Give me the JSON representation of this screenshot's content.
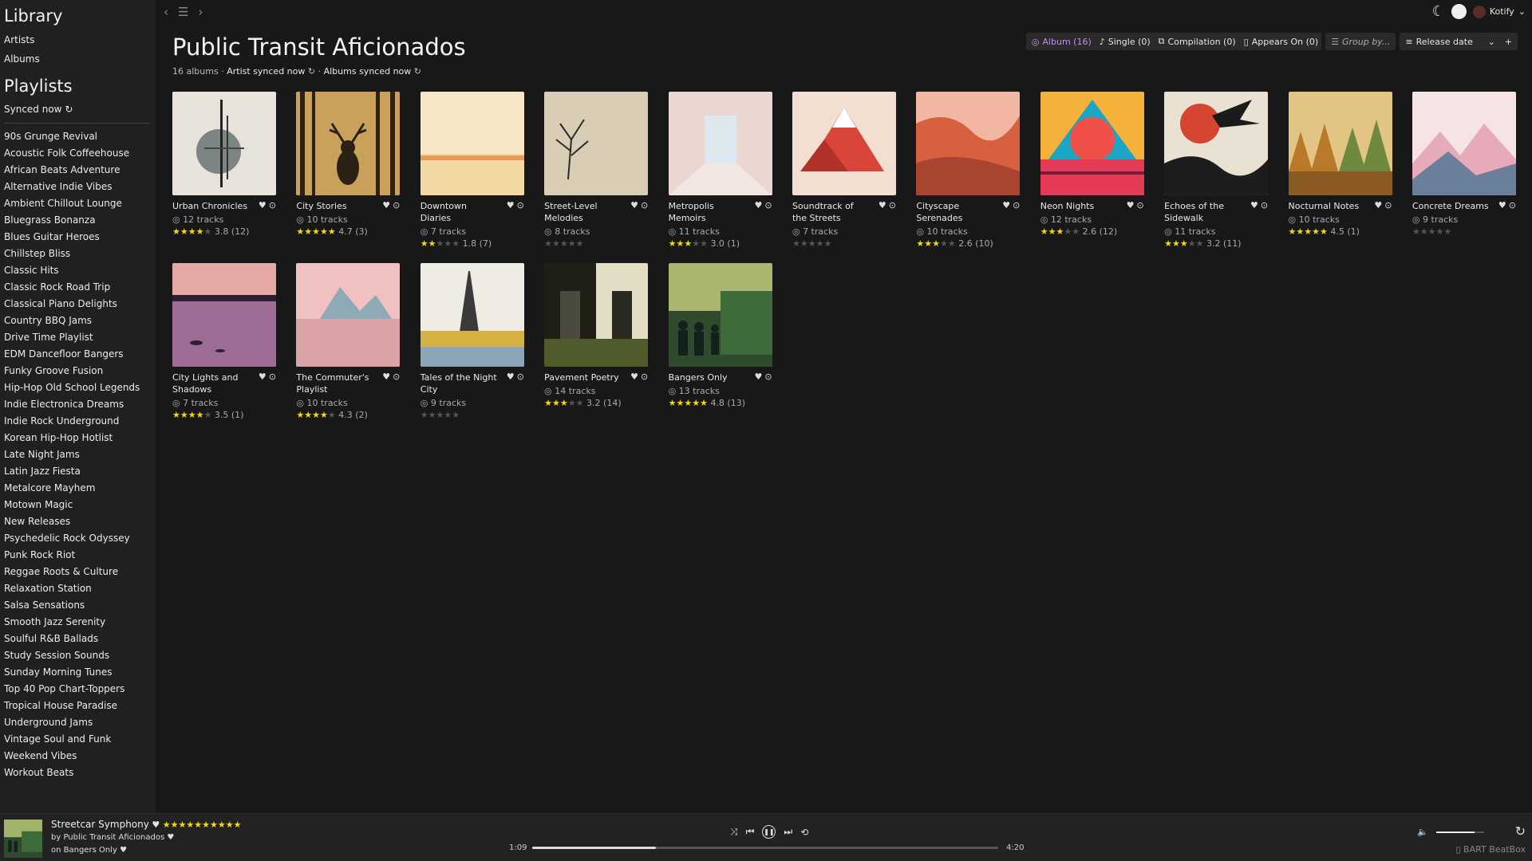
{
  "sidebar": {
    "library_heading": "Library",
    "artists_link": "Artists",
    "albums_link": "Albums",
    "playlists_heading": "Playlists",
    "synced_label": "Synced now",
    "playlists": [
      "90s Grunge Revival",
      "Acoustic Folk Coffeehouse",
      "African Beats Adventure",
      "Alternative Indie Vibes",
      "Ambient Chillout Lounge",
      "Bluegrass Bonanza",
      "Blues Guitar Heroes",
      "Chillstep Bliss",
      "Classic Hits",
      "Classic Rock Road Trip",
      "Classical Piano Delights",
      "Country BBQ Jams",
      "Drive Time Playlist",
      "EDM Dancefloor Bangers",
      "Funky Groove Fusion",
      "Hip-Hop Old School Legends",
      "Indie Electronica Dreams",
      "Indie Rock Underground",
      "Korean Hip-Hop Hotlist",
      "Late Night Jams",
      "Latin Jazz Fiesta",
      "Metalcore Mayhem",
      "Motown Magic",
      "New Releases",
      "Psychedelic Rock Odyssey",
      "Punk Rock Riot",
      "Reggae Roots & Culture",
      "Relaxation Station",
      "Salsa Sensations",
      "Smooth Jazz Serenity",
      "Soulful R&B Ballads",
      "Study Session Sounds",
      "Sunday Morning Tunes",
      "Top 40 Pop Chart-Toppers",
      "Tropical House Paradise",
      "Underground Jams",
      "Vintage Soul and Funk",
      "Weekend Vibes",
      "Workout Beats"
    ]
  },
  "header": {
    "title": "Public Transit Aficionados",
    "album_count": "16 albums",
    "artist_synced": "Artist synced now",
    "albums_synced": "Albums synced now",
    "user": "Kotify"
  },
  "filters": {
    "album": "Album (16)",
    "single": "Single (0)",
    "compilation": "Compilation (0)",
    "appears_on": "Appears On (0)",
    "group_by": "Group by...",
    "sort": "Release date",
    "add": "+"
  },
  "albums": [
    {
      "title": "Urban Chronicles",
      "tracks": "12 tracks",
      "rating": 3.8,
      "rating_text": "3.8 (12)",
      "art": "urban"
    },
    {
      "title": "City Stories",
      "tracks": "10 tracks",
      "rating": 4.7,
      "rating_text": "4.7 (3)",
      "art": "deer"
    },
    {
      "title": "Downtown Diaries",
      "tracks": "7 tracks",
      "rating": 1.8,
      "rating_text": "1.8 (7)",
      "art": "beach"
    },
    {
      "title": "Street-Level Melodies",
      "tracks": "8 tracks",
      "rating": 0,
      "rating_text": "",
      "art": "tree"
    },
    {
      "title": "Metropolis Memoirs",
      "tracks": "11 tracks",
      "rating": 3.0,
      "rating_text": "3.0 (1)",
      "art": "room"
    },
    {
      "title": "Soundtrack of the Streets",
      "tracks": "7 tracks",
      "rating": 0,
      "rating_text": "",
      "art": "redmtn"
    },
    {
      "title": "Cityscape Serenades",
      "tracks": "10 tracks",
      "rating": 2.6,
      "rating_text": "2.6 (10)",
      "art": "canyon"
    },
    {
      "title": "Neon Nights",
      "tracks": "12 tracks",
      "rating": 2.6,
      "rating_text": "2.6 (12)",
      "art": "neon"
    },
    {
      "title": "Echoes of the Sidewalk",
      "tracks": "11 tracks",
      "rating": 3.2,
      "rating_text": "3.2 (11)",
      "art": "eagle"
    },
    {
      "title": "Nocturnal Notes",
      "tracks": "10 tracks",
      "rating": 4.5,
      "rating_text": "4.5 (1)",
      "art": "forest"
    },
    {
      "title": "Concrete Dreams",
      "tracks": "9 tracks",
      "rating": 0,
      "rating_text": "",
      "art": "snow"
    },
    {
      "title": "City Lights and Shadows",
      "tracks": "7 tracks",
      "rating": 3.5,
      "rating_text": "3.5 (1)",
      "art": "lake"
    },
    {
      "title": "The Commuter's Playlist",
      "tracks": "10 tracks",
      "rating": 4.3,
      "rating_text": "4.3 (2)",
      "art": "ice"
    },
    {
      "title": "Tales of the Night City",
      "tracks": "9 tracks",
      "rating": 0,
      "rating_text": "",
      "art": "eiffel"
    },
    {
      "title": "Pavement Poetry",
      "tracks": "14 tracks",
      "rating": 3.2,
      "rating_text": "3.2 (14)",
      "art": "doors"
    },
    {
      "title": "Bangers Only",
      "tracks": "13 tracks",
      "rating": 4.8,
      "rating_text": "4.8 (13)",
      "art": "train"
    }
  ],
  "player": {
    "song": "Streetcar Symphony",
    "artist": "by Public Transit Aficionados",
    "album": "on Bangers Only",
    "song_rating": 10,
    "elapsed": "1:09",
    "duration": "4:20",
    "progress": 0.265,
    "volume": 0.8,
    "device": "BART BeatBox"
  }
}
